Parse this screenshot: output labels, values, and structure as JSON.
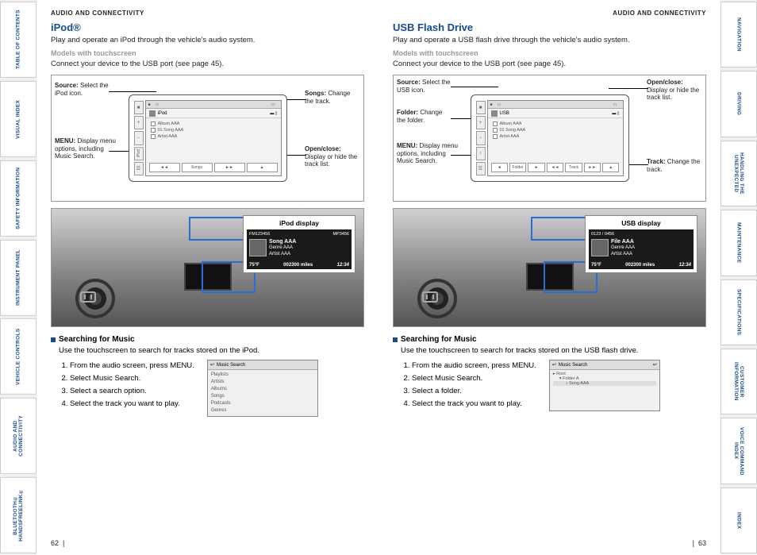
{
  "leftTabs": [
    "TABLE OF CONTENTS",
    "VISUAL INDEX",
    "SAFETY INFORMATION",
    "INSTRUMENT PANEL",
    "VEHICLE CONTROLS",
    "AUDIO AND CONNECTIVITY",
    "BLUETOOTH® HANDSFREELINK®"
  ],
  "rightTabs": [
    "NAVIGATION",
    "DRIVING",
    "HANDLING THE UNEXPECTED",
    "MAINTENANCE",
    "SPECIFICATIONS",
    "CUSTOMER INFORMATION",
    "VOICE COMMAND INDEX",
    "INDEX"
  ],
  "left": {
    "header": "AUDIO AND CONNECTIVITY",
    "title": "iPod®",
    "intro": "Play and operate an iPod through the vehicle's audio system.",
    "sub": "Models with touchscreen",
    "connect": "Connect your device to the USB port (see page 45).",
    "callouts": {
      "source": {
        "b": "Source:",
        "t": " Select the iPod icon."
      },
      "menu": {
        "b": "MENU:",
        "t": " Display menu options, including Music Search."
      },
      "songs": {
        "b": "Songs:",
        "t": " Change the track."
      },
      "open": {
        "b": "Open/close:",
        "t": " Display or hide the track list."
      }
    },
    "screen": {
      "srcLabel": "iPod",
      "rows": [
        "Album AAA",
        "01 Song AAA",
        "Artist AAA"
      ],
      "ctrl": [
        "◄◄",
        "Songs",
        "►►"
      ],
      "side": [
        "iPod"
      ]
    },
    "dashTitle": "iPod display",
    "mini": {
      "topL": "FM123456",
      "topR": "MP3456",
      "title": "Song AAA",
      "l2": "Genre AAA",
      "l3": "Artist AAA",
      "temp": "75°F",
      "odo": "002300 miles",
      "time": "12:34"
    },
    "searchHead": "Searching for Music",
    "searchBody": "Use the touchscreen to search for tracks stored on the iPod.",
    "steps": [
      "From the audio screen, press MENU.",
      "Select Music Search.",
      "Select a search option.",
      "Select the track you want to play."
    ],
    "searchBox": {
      "title": "Music Search",
      "items": [
        "Playlists",
        "Artists",
        "Albums",
        "Songs",
        "Podcasts",
        "Genres"
      ]
    },
    "pagenum": "62"
  },
  "right": {
    "header": "AUDIO AND CONNECTIVITY",
    "title": "USB Flash Drive",
    "intro": "Play and operate a USB flash drive through the vehicle's audio system.",
    "sub": "Models with touchscreen",
    "connect": "Connect your device to the USB port (see page 45).",
    "callouts": {
      "source": {
        "b": "Source:",
        "t": " Select the USB icon."
      },
      "folder": {
        "b": "Folder:",
        "t": " Change the folder."
      },
      "menu": {
        "b": "MENU:",
        "t": " Display menu options, including Music Search."
      },
      "open": {
        "b": "Open/close:",
        "t": " Display or hide the track list."
      },
      "track": {
        "b": "Track:",
        "t": " Change the track."
      }
    },
    "screen": {
      "srcLabel": "USB",
      "rows": [
        "Album AAA",
        "01 Song AAA",
        "Artist AAA"
      ],
      "ctrl": [
        "◄",
        "Folder",
        "►",
        "◄◄",
        "Track",
        "►►"
      ],
      "side": [
        ""
      ]
    },
    "dashTitle": "USB display",
    "mini": {
      "topL": "0123 / 0456",
      "topR": "",
      "title": "File AAA",
      "l2": "Genre AAA",
      "l3": "Artist AAA",
      "temp": "75°F",
      "odo": "002300 miles",
      "time": "12:34"
    },
    "searchHead": "Searching for Music",
    "searchBody": "Use the touchscreen to search for tracks stored on the USB flash drive.",
    "steps": [
      "From the audio screen, press MENU.",
      "Select Music Search.",
      "Select a folder.",
      "Select the track you want to play."
    ],
    "searchBox": {
      "title": "Music Search",
      "items": [
        "Root",
        "Folder A",
        "Song AAA"
      ]
    },
    "pagenum": "63"
  }
}
